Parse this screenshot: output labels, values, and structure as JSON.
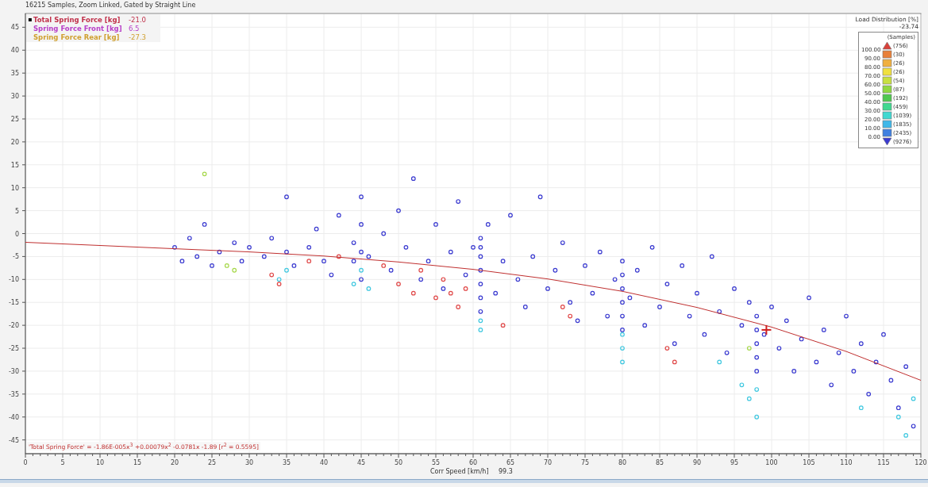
{
  "header": {
    "title": "16215 Samples, Zoom Linked, Gated by Straight Line"
  },
  "channels": [
    {
      "marker": "▪",
      "name": "Total Spring Force [kg]",
      "value": "-21.0",
      "color": "#c0304a"
    },
    {
      "name": "Spring Force Front [kg]",
      "value": "6.5",
      "color": "#b840c8"
    },
    {
      "name": "Spring Force Rear [kg]",
      "value": "-27.3",
      "color": "#d0a030"
    }
  ],
  "scale": {
    "title": "Load Distribution [%]",
    "value": "-23.74",
    "subtitle": "(Samples)",
    "labels": [
      "100.00",
      "90.00",
      "80.00",
      "70.00",
      "60.00",
      "50.00",
      "40.00",
      "30.00",
      "20.00",
      "10.00",
      "0.00"
    ],
    "bins": [
      {
        "kind": "up",
        "count": "(756)",
        "color": "#d9413a"
      },
      {
        "kind": "box",
        "count": "(30)",
        "color": "#e8803a"
      },
      {
        "kind": "box",
        "count": "(26)",
        "color": "#f0b040"
      },
      {
        "kind": "box",
        "count": "(26)",
        "color": "#f0e040"
      },
      {
        "kind": "box",
        "count": "(54)",
        "color": "#c8e040"
      },
      {
        "kind": "box",
        "count": "(87)",
        "color": "#90d840"
      },
      {
        "kind": "box",
        "count": "(192)",
        "color": "#50c850"
      },
      {
        "kind": "box",
        "count": "(459)",
        "color": "#40d890"
      },
      {
        "kind": "box",
        "count": "(1039)",
        "color": "#40d8d0"
      },
      {
        "kind": "box",
        "count": "(1835)",
        "color": "#40b8e8"
      },
      {
        "kind": "box",
        "count": "(2435)",
        "color": "#4080e0"
      },
      {
        "kind": "down",
        "count": "(9276)",
        "color": "#3a3ad0"
      }
    ]
  },
  "chart": {
    "chart_data": {
      "type": "scatter",
      "xlabel": "Corr Speed [km/h]",
      "grid": true,
      "xlim": [
        0,
        120
      ],
      "ylim": [
        -48,
        48
      ],
      "xticks": [
        0,
        5,
        10,
        15,
        20,
        25,
        30,
        35,
        40,
        45,
        50,
        55,
        60,
        65,
        70,
        75,
        80,
        85,
        90,
        95,
        100,
        105,
        110,
        115,
        120
      ],
      "yticks": [
        -45,
        -40,
        -35,
        -30,
        -25,
        -20,
        -15,
        -10,
        -5,
        0,
        5,
        10,
        15,
        20,
        25,
        30,
        35,
        40,
        45
      ],
      "series": [
        {
          "color": "#3a3ad0",
          "x": [
            20,
            21,
            22,
            23,
            24,
            25,
            26,
            28,
            29,
            30,
            32,
            33,
            35,
            35,
            36,
            38,
            39,
            40,
            41,
            42,
            44,
            44,
            45,
            45,
            45,
            45,
            46,
            48,
            49,
            50,
            51,
            52,
            53,
            54,
            55,
            56,
            57,
            58,
            59,
            60,
            61,
            61,
            61,
            61,
            61,
            61,
            61,
            62,
            63,
            64,
            65,
            66,
            67,
            68,
            69,
            70,
            71,
            72,
            73,
            74,
            75,
            76,
            77,
            78,
            79,
            80,
            80,
            80,
            80,
            80,
            80,
            81,
            82,
            83,
            84,
            85,
            86,
            87,
            88,
            89,
            90,
            91,
            92,
            93,
            94,
            95,
            96,
            97,
            98,
            98,
            98,
            98,
            98,
            99,
            100,
            101,
            102,
            103,
            104,
            105,
            106,
            107,
            108,
            109,
            110,
            111,
            112,
            113,
            114,
            115,
            116,
            117,
            118,
            119
          ],
          "values": [
            -3,
            -6,
            -1,
            -5,
            2,
            -7,
            -4,
            -2,
            -6,
            -3,
            -5,
            -1,
            -4,
            8,
            -7,
            -3,
            1,
            -6,
            -9,
            4,
            -2,
            -6,
            -10,
            -4,
            2,
            8,
            -5,
            0,
            -8,
            5,
            -3,
            12,
            -10,
            -6,
            2,
            -12,
            -4,
            7,
            -9,
            -3,
            -1,
            -5,
            -8,
            -11,
            -14,
            -17,
            -3,
            2,
            -13,
            -6,
            4,
            -10,
            -16,
            -5,
            8,
            -12,
            -8,
            -2,
            -15,
            -19,
            -7,
            -13,
            -4,
            -18,
            -10,
            -6,
            -9,
            -12,
            -15,
            -18,
            -21,
            -14,
            -8,
            -20,
            -3,
            -16,
            -11,
            -24,
            -7,
            -18,
            -13,
            -22,
            -5,
            -17,
            -26,
            -12,
            -20,
            -15,
            -18,
            -21,
            -24,
            -27,
            -30,
            -22,
            -16,
            -25,
            -19,
            -30,
            -23,
            -14,
            -28,
            -21,
            -33,
            -26,
            -18,
            -30,
            -24,
            -35,
            -28,
            -22,
            -32,
            -38,
            -29,
            -42
          ]
        },
        {
          "color": "#40c8e0",
          "x": [
            34,
            35,
            44,
            45,
            46,
            61,
            61,
            80,
            80,
            80,
            93,
            96,
            97,
            98,
            98,
            117,
            118,
            119,
            112
          ],
          "values": [
            -10,
            -8,
            -11,
            -8,
            -12,
            -19,
            -21,
            -22,
            -25,
            -28,
            -28,
            -33,
            -36,
            -40,
            -34,
            -40,
            -44,
            -36,
            -38
          ]
        },
        {
          "color": "#e04848",
          "x": [
            33,
            34,
            38,
            42,
            48,
            50,
            52,
            53,
            55,
            56,
            57,
            58,
            59,
            64,
            72,
            73,
            86,
            87
          ],
          "values": [
            -9,
            -11,
            -6,
            -5,
            -7,
            -11,
            -13,
            -8,
            -14,
            -10,
            -13,
            -16,
            -12,
            -20,
            -16,
            -18,
            -25,
            -28
          ]
        },
        {
          "color": "#a6d84a",
          "x": [
            27,
            28,
            24,
            97
          ],
          "values": [
            -7,
            -8,
            13,
            -25
          ]
        },
        {
          "type": "line",
          "color": "#c03030",
          "x": [
            0,
            10,
            20,
            30,
            40,
            50,
            60,
            70,
            80,
            90,
            100,
            110,
            120
          ],
          "values": [
            -1.9,
            -2.6,
            -3.3,
            -4,
            -4.9,
            -6.2,
            -7.8,
            -9.9,
            -12.6,
            -16.1,
            -20.4,
            -25.7,
            -32
          ]
        }
      ],
      "annotations": [
        {
          "text": "'Total Spring Force' = -1.86E-005x$^{3}$ +0.00079x$^{2}$ -0.0781x -1.89 [r$^{2}$ = 0.5595]"
        }
      ]
    },
    "cursor": {
      "readout": "99.3"
    }
  }
}
